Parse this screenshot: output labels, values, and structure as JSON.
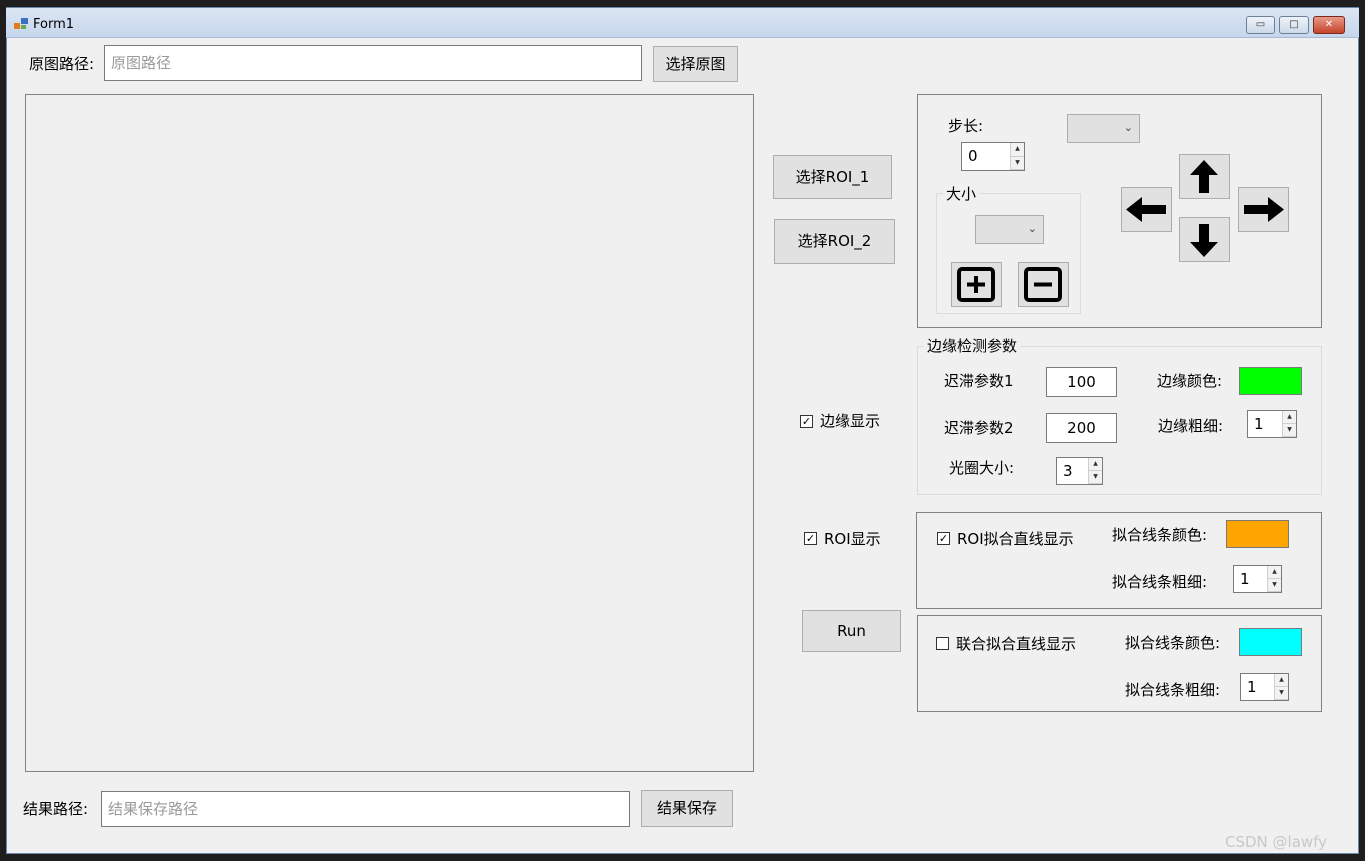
{
  "window": {
    "title": "Form1",
    "minimize": "▭",
    "maximize": "□",
    "close": "✕"
  },
  "source": {
    "label": "原图路径:",
    "placeholder": "原图路径",
    "button": "选择原图"
  },
  "result": {
    "label": "结果路径:",
    "placeholder": "结果保存路径",
    "button": "结果保存"
  },
  "roi_buttons": {
    "roi1": "选择ROI_1",
    "roi2": "选择ROI_2"
  },
  "move_panel": {
    "step_label": "步长:",
    "step_value": "0",
    "size_group": "大小",
    "arrows": {
      "up": "up-arrow",
      "down": "down-arrow",
      "left": "left-arrow",
      "right": "right-arrow"
    },
    "plus_icon": "plus-icon",
    "minus_icon": "minus-icon"
  },
  "edge": {
    "checkbox_label": "边缘显示",
    "checked": true,
    "group_title": "边缘检测参数",
    "hyst1_label": "迟滞参数1",
    "hyst1_value": "100",
    "hyst2_label": "迟滞参数2",
    "hyst2_value": "200",
    "aperture_label": "光圈大小:",
    "aperture_value": "3",
    "color_label": "边缘颜色:",
    "color": "#00ff00",
    "thickness_label": "边缘粗细:",
    "thickness_value": "1"
  },
  "roi": {
    "checkbox_label": "ROI显示",
    "checked": true,
    "fit_label": "ROI拟合直线显示",
    "fit_checked": true,
    "color_label": "拟合线条颜色:",
    "color": "#ffa500",
    "thickness_label": "拟合线条粗细:",
    "thickness_value": "1"
  },
  "run_button": "Run",
  "joint": {
    "fit_label": "联合拟合直线显示",
    "fit_checked": false,
    "color_label": "拟合线条颜色:",
    "color": "#00ffff",
    "thickness_label": "拟合线条粗细:",
    "thickness_value": "1"
  },
  "watermark": "CSDN @lawfy"
}
